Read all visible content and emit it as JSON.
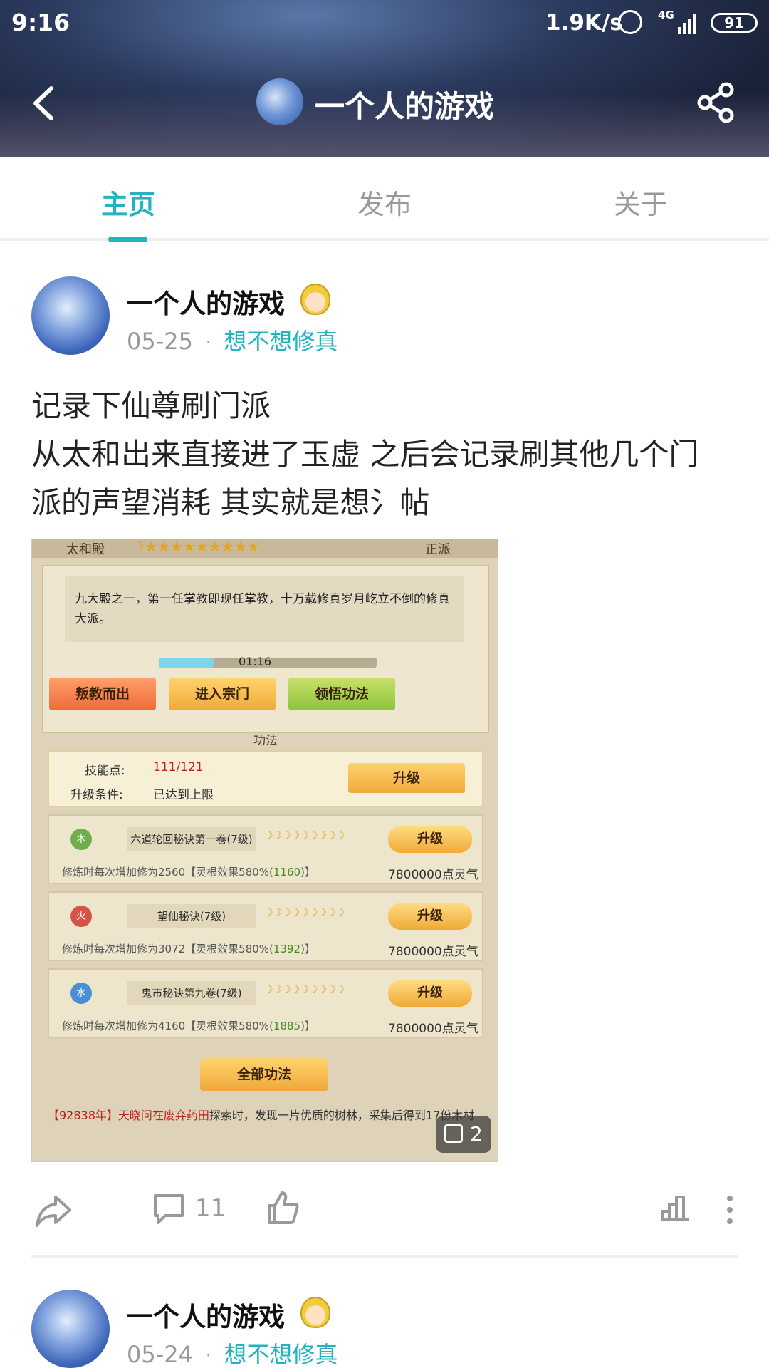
{
  "status_bar": {
    "time": "9:16",
    "speed": "1.9K/s",
    "network": "4G",
    "battery": "91"
  },
  "nav": {
    "title": "一个人的游戏",
    "icons": [
      "back-icon",
      "share-icon"
    ]
  },
  "tabs": [
    {
      "label": "主页",
      "active": true
    },
    {
      "label": "发布",
      "active": false
    },
    {
      "label": "关于",
      "active": false
    }
  ],
  "colors": {
    "accent": "#26b3c1",
    "text": "#222222",
    "muted": "#999999"
  },
  "posts": [
    {
      "author": "一个人的游戏",
      "date": "05-25",
      "separator": "·",
      "category": "想不想修真",
      "text_lines": [
        "记录下仙尊刷门派",
        "从太和出来直接进了玉虚 之后会记录刷其他几个门",
        "派的声望消耗 其实就是想氵帖"
      ],
      "image": {
        "header_left": "太和殿",
        "header_stars": "☽★★★★★★★★★",
        "header_right": "正派",
        "description": "九大殿之一，第一任掌教即现任掌教，十万载修真岁月屹立不倒的修真大派。",
        "timer": "01:16",
        "timer_progress": 0.25,
        "buttons": [
          "叛教而出",
          "进入宗门",
          "领悟功法"
        ],
        "section_title": "功法",
        "skill_points_label": "技能点:",
        "skill_points_value": "111/121",
        "upgrade_cond_label": "升级条件:",
        "upgrade_cond_value": "已达到上限",
        "upgrade_label": "升级",
        "skills": [
          {
            "element": "木",
            "element_color": "#6fae4a",
            "name": "六道轮回秘诀第一卷(7级)",
            "moons": "☽☽☽☽☽☽☽☽☽",
            "info_prefix": "修炼时每次增加修为2560【灵根效果580%(",
            "info_green": "1160",
            "info_suffix": ")】",
            "cost": "7800000点灵气"
          },
          {
            "element": "火",
            "element_color": "#d4544a",
            "name": "望仙秘诀(7级)",
            "moons": "☽☽☽☽☽☽☽☽☽",
            "info_prefix": "修炼时每次增加修为3072【灵根效果580%(",
            "info_green": "1392",
            "info_suffix": ")】",
            "cost": "7800000点灵气"
          },
          {
            "element": "水",
            "element_color": "#4a8fd4",
            "name": "鬼市秘诀第九卷(7级)",
            "moons": "☽☽☽☽☽☽☽☽☽",
            "info_prefix": "修炼时每次增加修为4160【灵根效果580%(",
            "info_green": "1885",
            "info_suffix": ")】",
            "cost": "7800000点灵气"
          }
        ],
        "all_button": "全部功法",
        "log_part1": "【92838年】天晓问在",
        "log_place": "废弃药田",
        "log_part2": "探索时，发现一片优质的树林，采集后得到17份木材",
        "image_count": "2"
      },
      "comment_count": "11"
    },
    {
      "author": "一个人的游戏",
      "date": "05-24",
      "separator": "·",
      "category": "想不想修真"
    }
  ]
}
